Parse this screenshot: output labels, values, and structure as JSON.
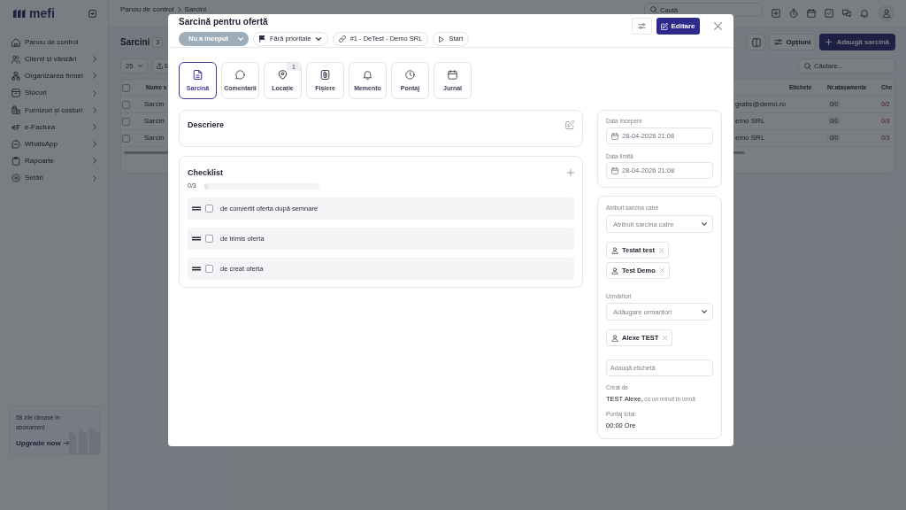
{
  "sidebar": {
    "logo": "mefi",
    "items": [
      {
        "label": "Panou de control",
        "expandable": false
      },
      {
        "label": "Clienți și vânzări",
        "expandable": true
      },
      {
        "label": "Organizarea firmei",
        "expandable": true
      },
      {
        "label": "Stocuri",
        "expandable": true
      },
      {
        "label": "Furnizori și costuri",
        "expandable": true
      },
      {
        "label": "e-Factura",
        "expandable": true
      },
      {
        "label": "WhatsApp",
        "expandable": true
      },
      {
        "label": "Rapoarte",
        "expandable": true
      },
      {
        "label": "Setări",
        "expandable": true
      }
    ],
    "promo": {
      "text": "58 zile rămase în abonament",
      "link": "Upgrade now"
    }
  },
  "topbar": {
    "breadcrumb": [
      "Panou de control",
      "Sarcini"
    ],
    "search": {
      "placeholder": "Caută"
    }
  },
  "page": {
    "title": "Sarcini",
    "count": "3",
    "options_button": "Opțiuni",
    "add_button": "Adaugă sarcină"
  },
  "toolbar": {
    "page_size": "25",
    "export_button": "E",
    "search": {
      "placeholder": "Căutare..."
    }
  },
  "table": {
    "columns": [
      {
        "label": "Nume s"
      },
      {
        "label": "Etichete"
      },
      {
        "label": "Nr.atașamente"
      },
      {
        "label": "Che"
      }
    ],
    "all_checked": false,
    "rows": [
      {
        "checked": false,
        "name": "Sarcin",
        "column_3": "gratis@demo.ro",
        "attachments": "0/0",
        "checklist": "0/2"
      },
      {
        "checked": false,
        "name": "Sarcin",
        "column_3": "emo SRL",
        "attachments": "0/0",
        "checklist": "0/3"
      },
      {
        "checked": false,
        "name": "Sarcin",
        "column_3": "emo SRL",
        "attachments": "0/0",
        "checklist": "0/3"
      }
    ]
  },
  "task_modal": {
    "title": "Sarcină pentru ofertă",
    "status": "Nu a început",
    "priority": "Fără prioritate",
    "linked_record": "#1 - DeTest - Demo SRL",
    "timer_button": "Start",
    "edit_button": "Editare",
    "tabs": [
      {
        "label": "Sarcină",
        "selected": true
      },
      {
        "label": "Comentarii",
        "selected": false
      },
      {
        "label": "Locație",
        "selected": false,
        "badge": "1"
      },
      {
        "label": "Fișiere",
        "selected": false
      },
      {
        "label": "Memento",
        "selected": false
      },
      {
        "label": "Pontaj",
        "selected": false
      },
      {
        "label": "Jurnal",
        "selected": false
      }
    ],
    "description": {
      "title": "Descriere"
    },
    "checklist": {
      "title": "Checklist",
      "progress": "0/3",
      "level": 0,
      "items": [
        {
          "text": "de convertit oferta după semnare",
          "checked": false
        },
        {
          "text": "de trimis oferta",
          "checked": false
        },
        {
          "text": "de creat oferta",
          "checked": false
        }
      ]
    },
    "dates": [
      {
        "label": "Data începere",
        "value": "28-04-2026 21:08"
      },
      {
        "label": "Data limită",
        "value": "28-04-2026 21:08"
      }
    ],
    "assignees": {
      "label": "Atribuit sarcina catre",
      "placeholder": "Atribuit sarcina catre",
      "people": [
        "Testat test",
        "Test Demo"
      ]
    },
    "followers": {
      "label": "Urmăritori",
      "placeholder": "Adăugare urmaritori",
      "people": [
        "Alexe TEST"
      ]
    },
    "tag_field": {
      "placeholder": "Adaugă etichetă"
    },
    "created": {
      "label": "Creat de",
      "text": "**TEST Alexe,** cu un minut în urmă"
    },
    "time_total": {
      "label": "Pontaj total:",
      "value": "00:00 Ore"
    }
  }
}
